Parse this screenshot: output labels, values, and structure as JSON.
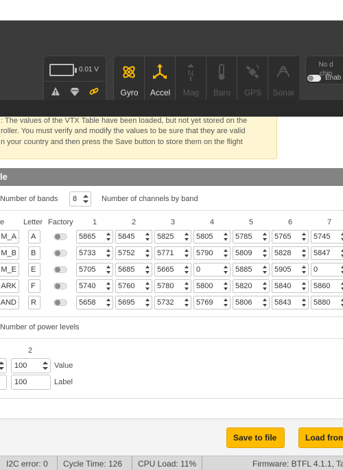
{
  "header": {
    "voltage": "0.01 V",
    "sensors": [
      {
        "label": "Gyro",
        "icon": "gyro-icon",
        "active": true
      },
      {
        "label": "Accel",
        "icon": "accel-icon",
        "active": true
      },
      {
        "label": "Mag",
        "icon": "mag-icon",
        "active": false
      },
      {
        "label": "Baro",
        "icon": "baro-icon",
        "active": false
      },
      {
        "label": "GPS",
        "icon": "gps-icon",
        "active": false
      },
      {
        "label": "Sonar",
        "icon": "sonar-icon",
        "active": false
      }
    ],
    "nodata_line1": "No d",
    "nodata_line2": "chip",
    "enable_label": "Enab",
    "sensor_active_color": "#ffbb00"
  },
  "note": {
    "line1_prefix": ":",
    "line1": " The values of the VTX Table have been loaded, but not yet stored on the",
    "line2": "roller. You must verify and modify the values to be sure that they are valid",
    "line3": "n your country and then press the Save button to store them on the flight"
  },
  "vtx": {
    "title": "le",
    "bands_label": "Number of bands",
    "bands_value": "8",
    "channels_label": "Number of channels by band",
    "col_name": "e",
    "col_letter": "Letter",
    "col_factory": "Factory",
    "channel_headers": [
      "1",
      "2",
      "3",
      "4",
      "5",
      "6",
      "7"
    ],
    "bands": [
      {
        "name": "M_A",
        "letter": "A",
        "freqs": [
          "5865",
          "5845",
          "5825",
          "5805",
          "5785",
          "5765",
          "5745"
        ]
      },
      {
        "name": "M_B",
        "letter": "B",
        "freqs": [
          "5733",
          "5752",
          "5771",
          "5790",
          "5809",
          "5828",
          "5847"
        ]
      },
      {
        "name": "M_E",
        "letter": "E",
        "freqs": [
          "5705",
          "5685",
          "5665",
          "0",
          "5885",
          "5905",
          "0"
        ]
      },
      {
        "name": "ARK",
        "letter": "F",
        "freqs": [
          "5740",
          "5760",
          "5780",
          "5800",
          "5820",
          "5840",
          "5860"
        ]
      },
      {
        "name": "AND",
        "letter": "R",
        "freqs": [
          "5658",
          "5695",
          "5732",
          "5769",
          "5806",
          "5843",
          "5880"
        ]
      }
    ],
    "power_levels_label": "Number of power levels",
    "power_col_header": "2",
    "power_value": "100",
    "power_value_label": "Value",
    "power_label_value": "100",
    "power_label_label": "Label"
  },
  "buttons": {
    "save": "Save to file",
    "load": "Load from file"
  },
  "status": {
    "i2c": "I2C error: 0",
    "cycle": "Cycle Time: 126",
    "cpu": "CPU Load: 11%",
    "firmware": "Firmware: BTFL 4.1.1, Ta"
  }
}
